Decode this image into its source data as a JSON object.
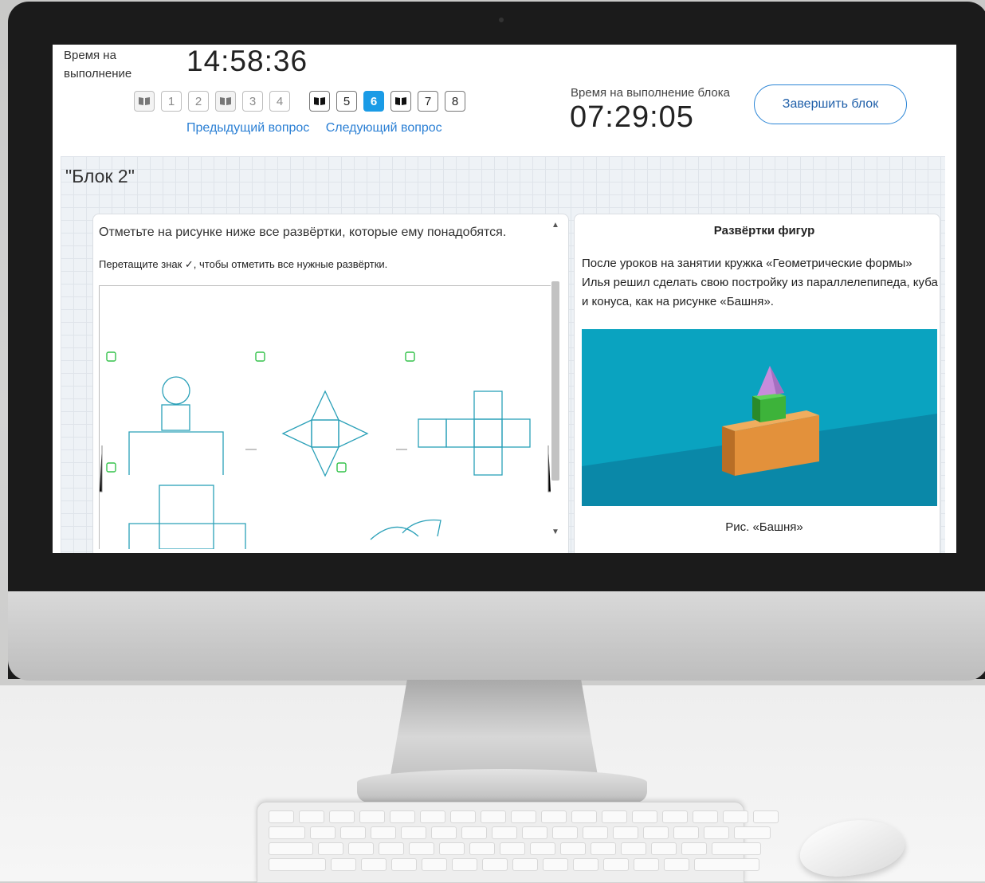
{
  "header": {
    "time_label": "Время на выполнение",
    "total_time": "14:58:36",
    "block_time_label": "Время на выполнение блока",
    "block_time": "07:29:05",
    "finish_button": "Завершить блок"
  },
  "question_nav": {
    "items": [
      {
        "type": "book",
        "label": ""
      },
      {
        "type": "num",
        "label": "1"
      },
      {
        "type": "num",
        "label": "2"
      },
      {
        "type": "book",
        "label": ""
      },
      {
        "type": "num",
        "label": "3"
      },
      {
        "type": "num",
        "label": "4"
      },
      {
        "type": "book",
        "label": ""
      },
      {
        "type": "num",
        "label": "5"
      },
      {
        "type": "num",
        "label": "6",
        "active": true
      },
      {
        "type": "book",
        "label": ""
      },
      {
        "type": "num",
        "label": "7"
      },
      {
        "type": "num",
        "label": "8"
      }
    ],
    "prev_label": "Предыдущий вопрос",
    "next_label": "Следующий вопрос"
  },
  "block": {
    "title": "\"Блок 2\""
  },
  "question": {
    "text": "Отметьте на рисунке ниже все развёртки, которые ему понадобятся.",
    "hint": "Перетащите знак ✓, чтобы отметить все нужные развёртки."
  },
  "info": {
    "title": "Развёртки фигур",
    "text": "После уроков на занятии кружка «Геометрические формы» Илья решил сделать свою постройку из параллелепипеда, куба и конуса, как на рисунке «Башня».",
    "caption": "Рис. «Башня»"
  },
  "colors": {
    "accent": "#1a9be6",
    "net_lines": "#2aa0b8",
    "checkbox": "#34c24a",
    "scene_top": "#0aa3c0",
    "scene_bottom": "#0a88a8",
    "box": "#e3913b",
    "cube": "#3db33a",
    "cone": "#c88cdc"
  },
  "icons": [
    "book-icon",
    "scroll-up-icon",
    "scroll-down-icon"
  ]
}
